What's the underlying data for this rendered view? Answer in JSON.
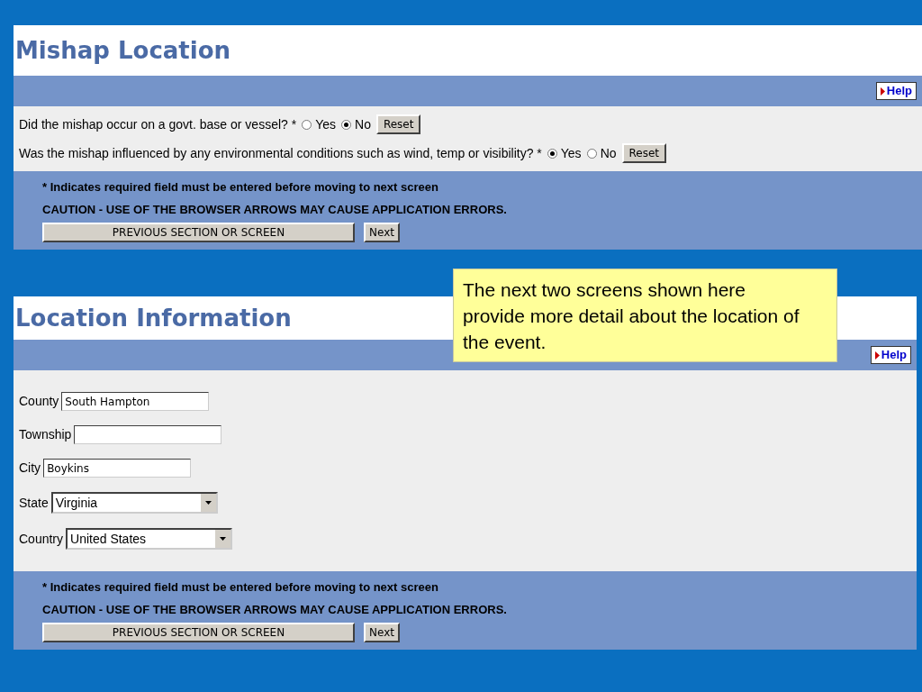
{
  "mishap_location": {
    "title": "Mishap Location",
    "help": "Help",
    "questions": [
      {
        "text": "Did the mishap occur on a govt. base or vessel? *",
        "options": [
          {
            "label": "Yes",
            "selected": false
          },
          {
            "label": "No",
            "selected": true
          }
        ],
        "reset": "Reset"
      },
      {
        "text": "Was the mishap influenced by any environmental conditions such as wind, temp or visibility? *",
        "options": [
          {
            "label": "Yes",
            "selected": true
          },
          {
            "label": "No",
            "selected": false
          }
        ],
        "reset": "Reset"
      }
    ],
    "footer": {
      "note": "* Indicates required field must be entered before moving to next screen",
      "caution": "CAUTION - USE OF THE BROWSER ARROWS MAY CAUSE APPLICATION ERRORS.",
      "previous": "PREVIOUS SECTION OR SCREEN",
      "next": "Next"
    }
  },
  "callout": "The next two screens shown here provide more detail about the location of the event.",
  "location_information": {
    "title": "Location Information",
    "help": "Help",
    "fields": [
      {
        "kind": "text",
        "label": "County",
        "value": "South Hampton"
      },
      {
        "kind": "text",
        "label": "Township"
      },
      {
        "kind": "text",
        "label": "City",
        "value": "Boykins"
      },
      {
        "kind": "select",
        "label": "State",
        "value": "Virginia"
      },
      {
        "kind": "select",
        "label": "Country",
        "value": "United States"
      }
    ],
    "footer": {
      "note": "* Indicates required field must be entered before moving to next screen",
      "caution": "CAUTION - USE OF THE BROWSER ARROWS MAY CAUSE APPLICATION ERRORS.",
      "previous": "PREVIOUS SECTION OR SCREEN",
      "next": "Next"
    }
  }
}
